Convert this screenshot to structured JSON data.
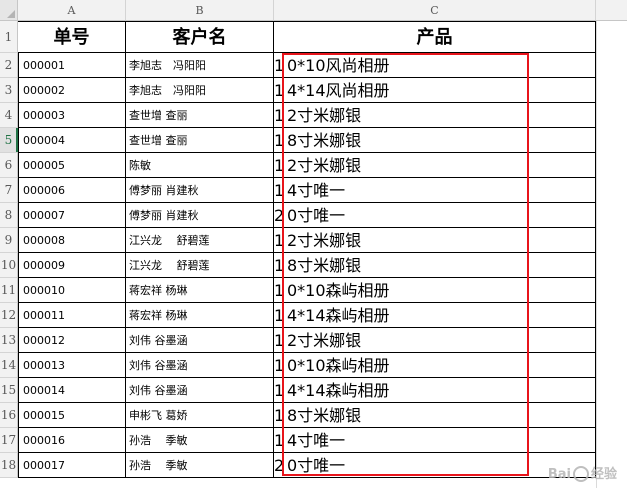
{
  "columns": [
    "A",
    "B",
    "C"
  ],
  "header_row": {
    "row_label": "1",
    "col_a": "单号",
    "col_b": "客户名",
    "col_c": "产品"
  },
  "active_row": "5",
  "rows": [
    {
      "row_label": "2",
      "order_no": "000001",
      "customer": "李旭志　冯阳阳",
      "prefix": "1",
      "product": "0*10风尚相册"
    },
    {
      "row_label": "3",
      "order_no": "000002",
      "customer": "李旭志　冯阳阳",
      "prefix": "1",
      "product": "4*14风尚相册"
    },
    {
      "row_label": "4",
      "order_no": "000003",
      "customer": "查世增  查丽",
      "prefix": "1",
      "product": "2寸米娜银"
    },
    {
      "row_label": "5",
      "order_no": "000004",
      "customer": "查世增  查丽",
      "prefix": "1",
      "product": "8寸米娜银"
    },
    {
      "row_label": "6",
      "order_no": "000005",
      "customer": "陈敏",
      "prefix": "1",
      "product": "2寸米娜银"
    },
    {
      "row_label": "7",
      "order_no": "000006",
      "customer": "傅梦丽  肖建秋",
      "prefix": "1",
      "product": "4寸唯一"
    },
    {
      "row_label": "8",
      "order_no": "000007",
      "customer": "傅梦丽  肖建秋",
      "prefix": "2",
      "product": "0寸唯一"
    },
    {
      "row_label": "9",
      "order_no": "000008",
      "customer": "江兴龙　  舒碧莲",
      "prefix": "1",
      "product": "2寸米娜银"
    },
    {
      "row_label": "10",
      "order_no": "000009",
      "customer": "江兴龙　  舒碧莲",
      "prefix": "1",
      "product": "8寸米娜银"
    },
    {
      "row_label": "11",
      "order_no": "000010",
      "customer": "蒋宏祥  杨琳",
      "prefix": "1",
      "product": "0*10森屿相册"
    },
    {
      "row_label": "12",
      "order_no": "000011",
      "customer": "蒋宏祥  杨琳",
      "prefix": "1",
      "product": "4*14森屿相册"
    },
    {
      "row_label": "13",
      "order_no": "000012",
      "customer": "刘伟  谷墨涵",
      "prefix": "1",
      "product": "2寸米娜银"
    },
    {
      "row_label": "14",
      "order_no": "000013",
      "customer": "刘伟  谷墨涵",
      "prefix": "1",
      "product": "0*10森屿相册"
    },
    {
      "row_label": "15",
      "order_no": "000014",
      "customer": "刘伟  谷墨涵",
      "prefix": "1",
      "product": "4*14森屿相册"
    },
    {
      "row_label": "16",
      "order_no": "000015",
      "customer": "申彬飞  葛娇",
      "prefix": "1",
      "product": "8寸米娜银"
    },
    {
      "row_label": "17",
      "order_no": "000016",
      "customer": "孙浩　  季敏",
      "prefix": "1",
      "product": "4寸唯一"
    },
    {
      "row_label": "18",
      "order_no": "000017",
      "customer": "孙浩　  季敏",
      "prefix": "2",
      "product": "0寸唯一"
    }
  ],
  "watermark": {
    "text_a": "Bai",
    "text_b": "经验"
  },
  "colors": {
    "highlight": "#e8141b",
    "active_row": "#217346"
  }
}
